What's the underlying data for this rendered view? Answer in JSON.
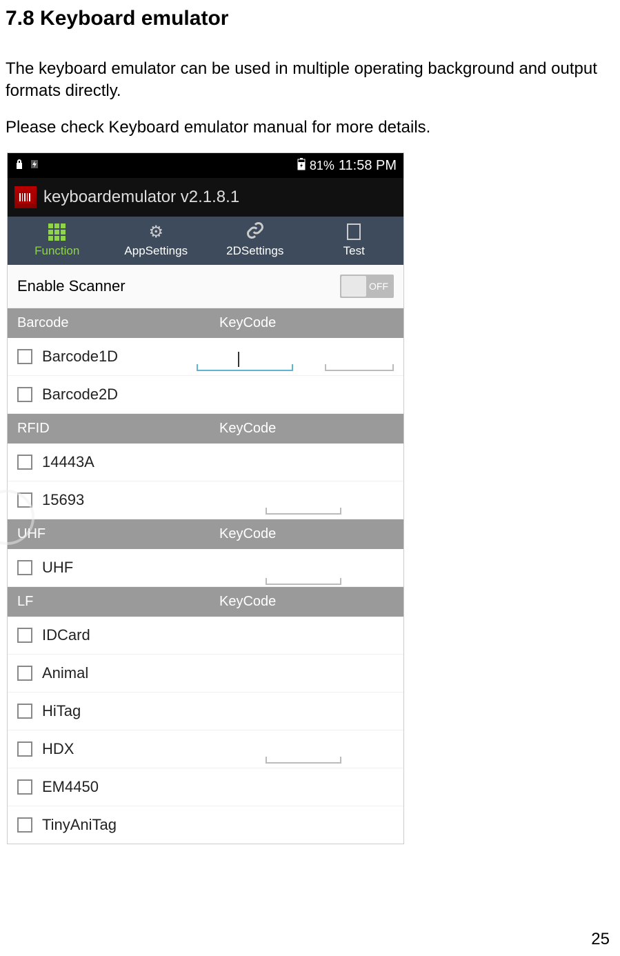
{
  "document": {
    "heading": "7.8 Keyboard emulator",
    "paragraph1": "The keyboard emulator can be used in multiple operating background and output formats directly.",
    "paragraph2": "Please check Keyboard emulator manual for more details.",
    "page_number": "25"
  },
  "status_bar": {
    "battery_percent": "81%",
    "time": "11:58 PM"
  },
  "app": {
    "title": "keyboardemulator v2.1.8.1"
  },
  "tabs": [
    {
      "label": "Function"
    },
    {
      "label": "AppSettings"
    },
    {
      "label": "2DSettings"
    },
    {
      "label": "Test"
    }
  ],
  "enable_scanner": {
    "label": "Enable Scanner",
    "state": "OFF"
  },
  "sections": {
    "barcode": {
      "title": "Barcode",
      "keycode_label": "KeyCode"
    },
    "rfid": {
      "title": "RFID",
      "keycode_label": "KeyCode"
    },
    "uhf": {
      "title": "UHF",
      "keycode_label": "KeyCode"
    },
    "lf": {
      "title": "LF",
      "keycode_label": "KeyCode"
    }
  },
  "barcode_items": [
    {
      "label": "Barcode1D"
    },
    {
      "label": "Barcode2D"
    }
  ],
  "rfid_items": [
    {
      "label": "14443A"
    },
    {
      "label": "15693"
    }
  ],
  "uhf_items": [
    {
      "label": "UHF"
    }
  ],
  "lf_items": [
    {
      "label": "IDCard"
    },
    {
      "label": "Animal"
    },
    {
      "label": "HiTag"
    },
    {
      "label": "HDX"
    },
    {
      "label": "EM4450"
    },
    {
      "label": "TinyAniTag"
    }
  ]
}
